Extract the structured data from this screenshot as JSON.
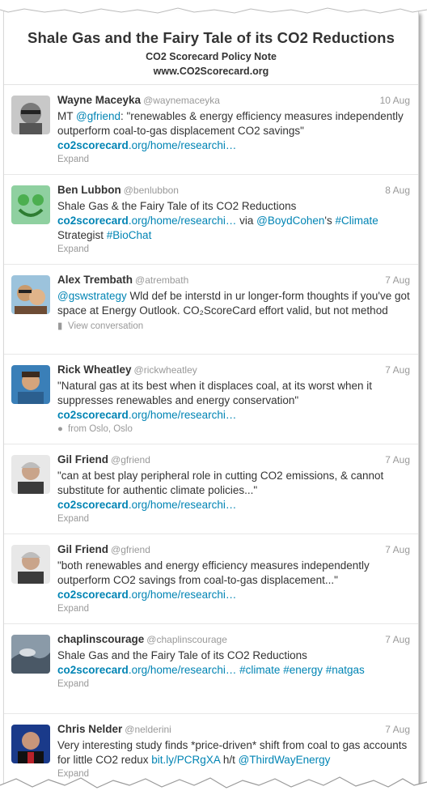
{
  "header": {
    "title": "Shale Gas and the Fairy Tale of its CO2 Reductions",
    "subtitle": "CO2 Scorecard Policy Note",
    "url": "www.CO2Scorecard.org"
  },
  "colors": {
    "link": "#0084b4",
    "muted": "#999999",
    "text": "#333333"
  },
  "tweets": [
    {
      "name": "Wayne Maceyka",
      "handle": "@waynemaceyka",
      "date": "10 Aug",
      "t1": "MT ",
      "m1": "@gfriend",
      "t2": ": \"renewables & energy efficiency measures independently outperform coal-to-gas displacement CO2 savings\" ",
      "link_bold": "co2scorecard",
      "link_rest": ".org/home/researchi…",
      "footer": "Expand",
      "footer_icon": ""
    },
    {
      "name": "Ben Lubbon",
      "handle": "@benlubbon",
      "date": "8 Aug",
      "t1": "Shale Gas & the Fairy Tale of its CO2 Reductions ",
      "link_bold": "co2scorecard",
      "link_rest": ".org/home/researchi…",
      "t2": " via ",
      "m1": "@BoydCohen",
      "t3": "'s ",
      "h1": "#Climate",
      "t4": " Strategist ",
      "h2": "#BioChat",
      "footer": "Expand",
      "footer_icon": ""
    },
    {
      "name": "Alex Trembath",
      "handle": "@atrembath",
      "date": "7 Aug",
      "m1": "@gswstrategy",
      "t1": " Wld def be interstd in ur longer-form thoughts if you've got space at Energy Outlook. CO₂ScoreCard effort valid, but not method",
      "footer": "View conversation",
      "footer_icon": "speech-bubble-icon"
    },
    {
      "name": "Rick Wheatley",
      "handle": "@rickwheatley",
      "date": "7 Aug",
      "t1": "\"Natural gas at its best when it displaces coal, at its worst when it suppresses renewables and energy conservation\" ",
      "link_bold": "co2scorecard",
      "link_rest": ".org/home/researchi…",
      "footer": "from Oslo, Oslo",
      "footer_icon": "location-pin-icon"
    },
    {
      "name": "Gil Friend",
      "handle": "@gfriend",
      "date": "7 Aug",
      "t1": "\"can at best play peripheral role in cutting CO2 emissions, & cannot substitute for authentic climate policies...\" ",
      "link_bold": "co2scorecard",
      "link_rest": ".org/home/researchi…",
      "footer": "Expand",
      "footer_icon": ""
    },
    {
      "name": "Gil Friend",
      "handle": "@gfriend",
      "date": "7 Aug",
      "t1": "\"both renewables and energy efficiency measures independently outperform CO2 savings from coal-to-gas displacement...\" ",
      "link_bold": "co2scorecard",
      "link_rest": ".org/home/researchi…",
      "footer": "Expand",
      "footer_icon": ""
    },
    {
      "name": "chaplinscourage",
      "handle": "@chaplinscourage",
      "date": "7 Aug",
      "t1": "Shale Gas and the Fairy Tale of its CO2 Reductions ",
      "link_bold": "co2scorecard",
      "link_rest": ".org/home/researchi…",
      "h1": "#climate",
      "h2": "#energy",
      "h3": "#natgas",
      "footer": "Expand",
      "footer_icon": ""
    },
    {
      "name": "Chris Nelder",
      "handle": "@nelderini",
      "date": "7 Aug",
      "t1": "Very interesting study finds *price-driven* shift from coal to gas accounts for little CO2 redux ",
      "l1": "bit.ly/PCRgXA",
      "t2": " h/t ",
      "m1": "@ThirdWayEnergy",
      "footer": "Expand",
      "footer_icon": ""
    }
  ]
}
